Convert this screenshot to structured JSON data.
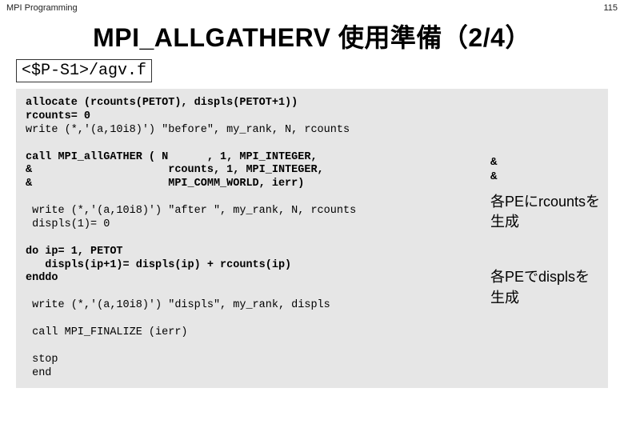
{
  "header": {
    "left": "MPI Programming",
    "right": "115"
  },
  "title": "MPI_ALLGATHERV 使用準備（2/4）",
  "path": "<$P-S1>/agv.f",
  "code": {
    "l1": "allocate (rcounts(PETOT), displs(PETOT+1))",
    "l2": "rcounts= 0",
    "l3": "write (*,'(a,10i8)') \"before\", my_rank, N, rcounts",
    "l4": "",
    "l5": "call MPI_allGATHER ( N      , 1, MPI_INTEGER,",
    "l6": "&                     rcounts, 1, MPI_INTEGER,",
    "l7": "&                     MPI_COMM_WORLD, ierr)",
    "l8": "",
    "l9": " write (*,'(a,10i8)') \"after \", my_rank, N, rcounts",
    "l10": " displs(1)= 0",
    "l11": "",
    "l12": "do ip= 1, PETOT",
    "l13": "   displs(ip+1)= displs(ip) + rcounts(ip)",
    "l14": "enddo",
    "l15": "",
    "l16": " write (*,'(a,10i8)') \"displs\", my_rank, displs",
    "l17": "",
    "l18": " call MPI_FINALIZE (ierr)",
    "l19": "",
    "l20": " stop",
    "l21": " end"
  },
  "annotations": {
    "amp1": "&",
    "amp2": "&",
    "note1_l1": "各PEにrcountsを",
    "note1_l2": "生成",
    "note2_l1": "各PEでdisplsを",
    "note2_l2": "生成"
  }
}
